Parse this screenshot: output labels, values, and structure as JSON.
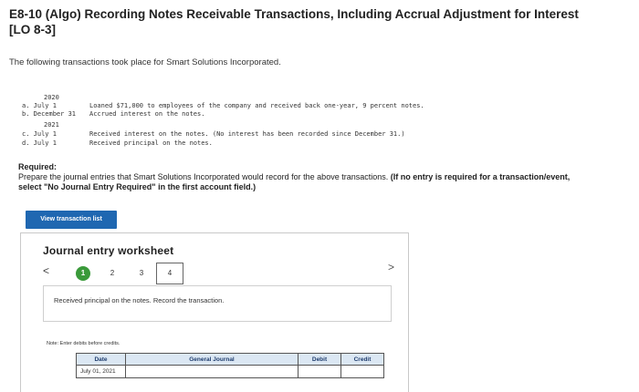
{
  "title": "E8-10 (Algo) Recording Notes Receivable Transactions, Including Accrual Adjustment for Interest [LO 8-3]",
  "intro": "The following transactions took place for Smart Solutions Incorporated.",
  "transactions": {
    "year1": "2020",
    "a_label": "a. July 1",
    "a_text": "Loaned $71,000 to employees of the company and received back one-year, 9 percent notes.",
    "b_label": "b. December 31",
    "b_text": "Accrued interest on the notes.",
    "year2": "2021",
    "c_label": "c. July 1",
    "c_text": "Received interest on the notes. (No interest has been recorded since December 31.)",
    "d_label": "d. July 1",
    "d_text": "Received principal on the notes."
  },
  "required": {
    "label": "Required:",
    "text": "Prepare the journal entries that Smart Solutions Incorporated would record for the above transactions. ",
    "bold_text": "(If no entry is required for a transaction/event, select \"No Journal Entry Required\" in the first account field.)"
  },
  "view_button": "View transaction list",
  "worksheet": {
    "title": "Journal entry worksheet",
    "prev": "<",
    "next": ">",
    "steps": [
      "1",
      "2",
      "3",
      "4"
    ],
    "description": "Received principal on the notes. Record the transaction.",
    "note": "Note: Enter debits before credits.",
    "columns": {
      "date": "Date",
      "journal": "General Journal",
      "debit": "Debit",
      "credit": "Credit"
    },
    "row_date": "July 01, 2021"
  }
}
